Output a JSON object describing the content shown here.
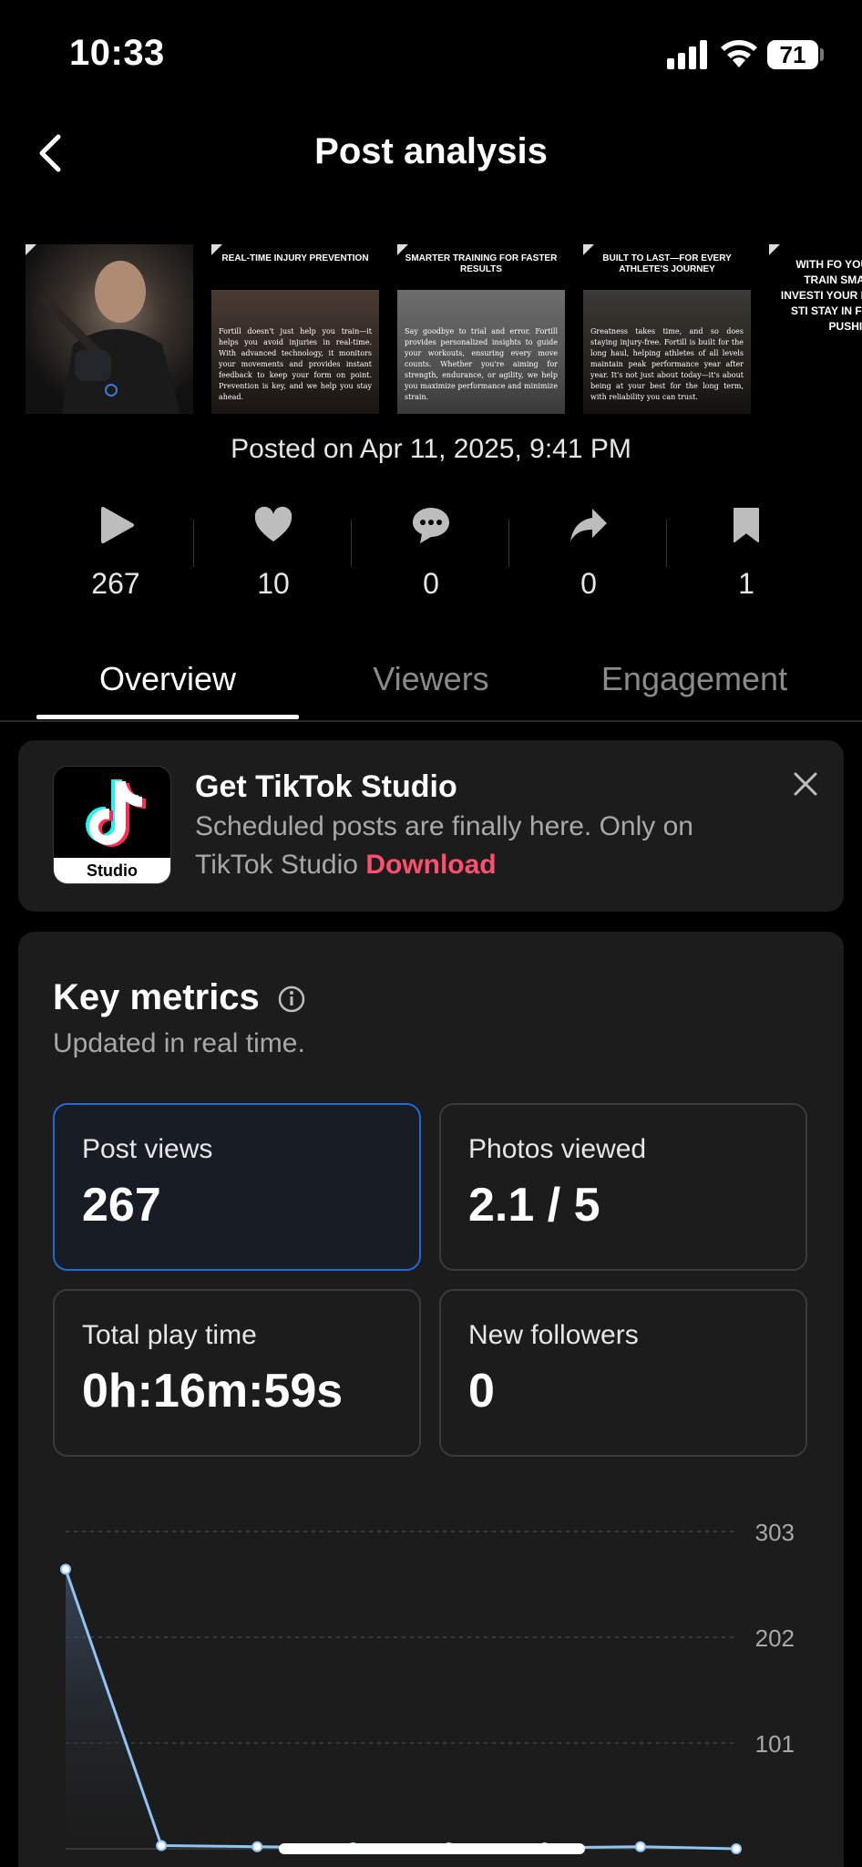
{
  "status_bar": {
    "time": "10:33",
    "battery": "71"
  },
  "header": {
    "title": "Post analysis"
  },
  "thumbnails": [
    {
      "title": "",
      "body": ""
    },
    {
      "title": "REAL-TIME INJURY PREVENTION",
      "body": "Fortill doesn't just help you train—it helps you avoid injuries in real-time. With advanced technology, it monitors your movements and provides instant feedback to keep your form on point. Prevention is key, and we help you stay ahead."
    },
    {
      "title": "SMARTER TRAINING FOR FASTER RESULTS",
      "body": "Say goodbye to trial and error. Fortill provides personalized insights to guide your workouts, ensuring every move counts. Whether you're aiming for strength, endurance, or agility, we help you maximize performance and minimize strain."
    },
    {
      "title": "BUILT TO LAST—FOR EVERY ATHLETE'S JOURNEY",
      "body": "Greatness takes time, and so does staying injury-free. Fortill is built for the long haul, helping athletes of all levels maintain peak performance year after year. It's not just about today—it's about being at your best for the long term, with reliability you can trust."
    },
    {
      "title": "WITH FO YOU'RE NO TRAIN SMART YOU INVESTI YOUR FU STAY STI STAY IN FREE, AN PUSHI FORWA",
      "body": ""
    }
  ],
  "posted": "Posted on Apr 11, 2025, 9:41 PM",
  "stats": [
    {
      "icon": "play-icon",
      "value": "267"
    },
    {
      "icon": "heart-icon",
      "value": "10"
    },
    {
      "icon": "comment-icon",
      "value": "0"
    },
    {
      "icon": "share-icon",
      "value": "0"
    },
    {
      "icon": "bookmark-icon",
      "value": "1"
    }
  ],
  "tabs": [
    "Overview",
    "Viewers",
    "Engagement"
  ],
  "promo": {
    "title": "Get TikTok Studio",
    "text": "Scheduled posts are finally here. Only on TikTok Studio",
    "link": "Download",
    "logo_label": "Studio"
  },
  "key_metrics": {
    "title": "Key metrics",
    "subtitle": "Updated in real time.",
    "tiles": [
      {
        "label": "Post views",
        "value": "267",
        "selected": true
      },
      {
        "label": "Photos viewed",
        "value": "2.1 / 5",
        "selected": false
      },
      {
        "label": "Total play time",
        "value": "0h:16m:59s",
        "selected": false
      },
      {
        "label": "New followers",
        "value": "0",
        "selected": false
      }
    ]
  },
  "colors": {
    "accent_blue": "#1f6bd6",
    "link_red": "#fe4f6f",
    "line": "#8ec5f5"
  },
  "chart_data": {
    "type": "line",
    "y_ticks": [
      "303",
      "202",
      "101"
    ],
    "ylim": [
      0,
      303
    ],
    "values": [
      267,
      3,
      2,
      1,
      1,
      1,
      2,
      0
    ],
    "grid": true
  }
}
